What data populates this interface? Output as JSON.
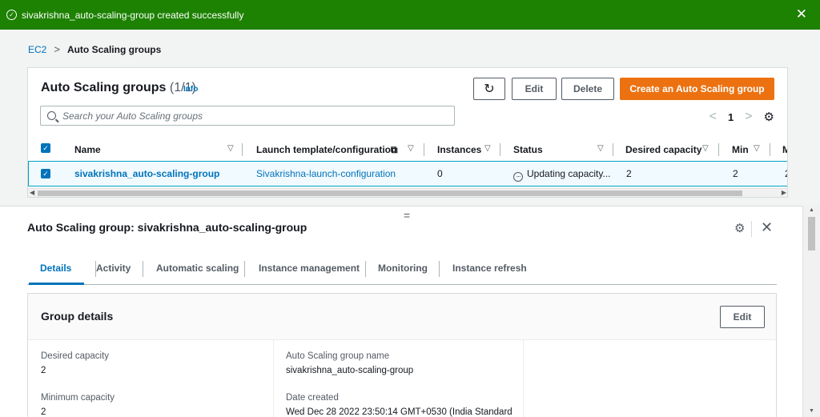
{
  "flash": {
    "icon": "check-circle-icon",
    "message": "sivakrishna_auto-scaling-group created successfully",
    "close_icon": "close-icon"
  },
  "breadcrumb": {
    "items": [
      "EC2",
      "Auto Scaling groups"
    ],
    "separator": ">"
  },
  "list_panel": {
    "title": "Auto Scaling groups",
    "count": "(1/1)",
    "info": "Info",
    "buttons": {
      "refresh_icon": "refresh-icon",
      "edit": "Edit",
      "delete": "Delete",
      "create": "Create an Auto Scaling group"
    },
    "search_placeholder": "Search your Auto Scaling groups",
    "pagination": {
      "prev": "<",
      "page": "1",
      "next": ">"
    },
    "columns": [
      "Name",
      "Launch template/configuration",
      "Instances",
      "Status",
      "Desired capacity",
      "Min",
      "M"
    ],
    "rows": [
      {
        "name": "sivakrishna_auto-scaling-group",
        "launch": "Sivakrishna-launch-configuration",
        "instances": "0",
        "status": "Updating capacity...",
        "desired": "2",
        "min": "2",
        "max": "2"
      }
    ]
  },
  "details": {
    "title": "Auto Scaling group: sivakrishna_auto-scaling-group",
    "handle": "=",
    "tabs": [
      "Details",
      "Activity",
      "Automatic scaling",
      "Instance management",
      "Monitoring",
      "Instance refresh"
    ],
    "active_tab": "Details",
    "group_details": {
      "title": "Group details",
      "edit": "Edit",
      "fields": [
        {
          "label": "Desired capacity",
          "value": "2"
        },
        {
          "label": "Minimum capacity",
          "value": "2"
        },
        {
          "label": "Auto Scaling group name",
          "value": "sivakrishna_auto-scaling-group"
        },
        {
          "label": "Date created",
          "value": "Wed Dec 28 2022 23:50:14 GMT+0530 (India Standard"
        }
      ]
    }
  },
  "colors": {
    "success": "#1d8102",
    "link": "#0073bb",
    "primary": "#ec7211"
  }
}
